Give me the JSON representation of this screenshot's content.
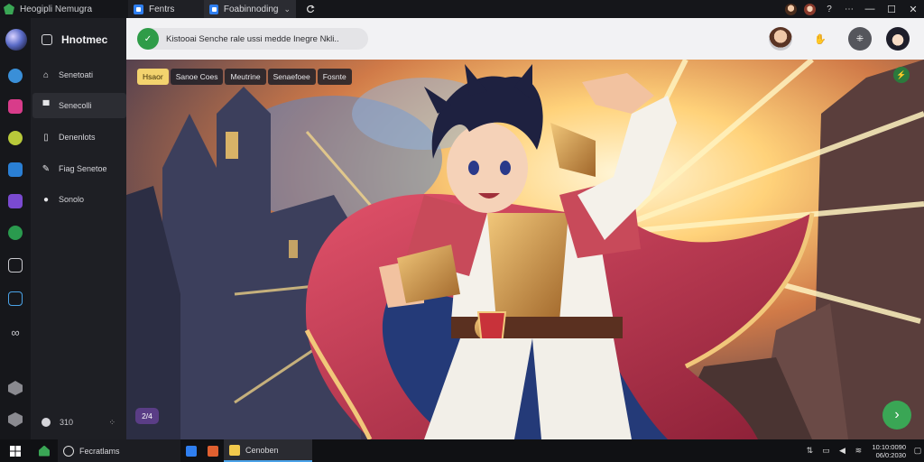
{
  "titlebar": {
    "app_name": "Heogipli Nemugra",
    "tabs": [
      {
        "label": "Fentrs"
      },
      {
        "label": "Foabinnoding"
      }
    ]
  },
  "nav": {
    "title": "Hnotmec",
    "items": [
      {
        "label": "Senetoati",
        "icon": "home-icon"
      },
      {
        "label": "Senecolli",
        "icon": "document-icon"
      },
      {
        "label": "Denenlots",
        "icon": "file-icon"
      },
      {
        "label": "Fiag Senetoe",
        "icon": "edit-icon"
      },
      {
        "label": "Sonolo",
        "icon": "settings-icon"
      }
    ],
    "footer_label": "310"
  },
  "search": {
    "text": "Kistooai Senche rale ussi medde Inegre Nkli.."
  },
  "filters": [
    {
      "label": "Hsaor",
      "active": true
    },
    {
      "label": "Sanoe Coes",
      "active": false
    },
    {
      "label": "Meutrine",
      "active": false
    },
    {
      "label": "Senaefoee",
      "active": false
    },
    {
      "label": "Fosnte",
      "active": false
    }
  ],
  "canvas": {
    "counter": "2/4"
  },
  "taskbar": {
    "items": [
      {
        "label": "Fecratlams"
      },
      {
        "label": "Cenoben"
      }
    ],
    "clock_time": "10:10:0090",
    "clock_date": "06/0:2030"
  },
  "colors": {
    "accent_green": "#3aa655",
    "chip_active": "#f3d36e",
    "tab_blue": "#2f7ff0"
  }
}
